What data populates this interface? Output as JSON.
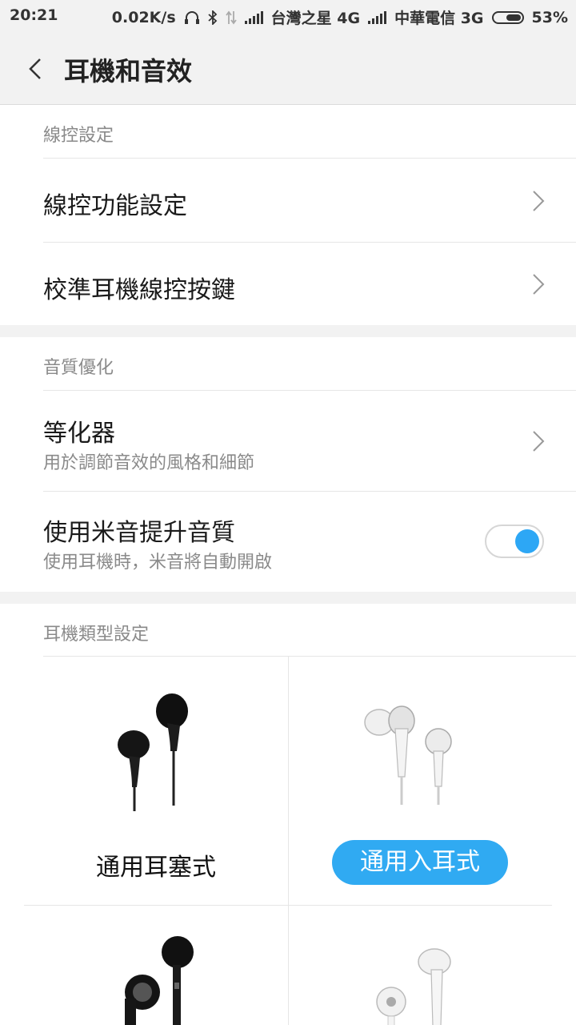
{
  "status": {
    "time": "20:21",
    "speed": "0.02K/s",
    "carrier1": "台灣之星 4G",
    "carrier2": "中華電信 3G",
    "battery": "53%"
  },
  "header": {
    "title": "耳機和音效"
  },
  "sections": {
    "line_control": {
      "label": "線控設定",
      "items": [
        {
          "title": "線控功能設定"
        },
        {
          "title": "校準耳機線控按鍵"
        }
      ]
    },
    "sound_quality": {
      "label": "音質優化",
      "items": [
        {
          "title": "等化器",
          "subtitle": "用於調節音效的風格和細節"
        },
        {
          "title": "使用米音提升音質",
          "subtitle": "使用耳機時，米音將自動開啟",
          "toggle_on": true
        }
      ]
    },
    "headphone_type": {
      "label": "耳機類型設定",
      "types": [
        {
          "label": "通用耳塞式",
          "selected": false
        },
        {
          "label": "通用入耳式",
          "selected": true
        }
      ]
    }
  },
  "colors": {
    "accent": "#30aaf2",
    "toggle_knob": "#2da7f5"
  }
}
